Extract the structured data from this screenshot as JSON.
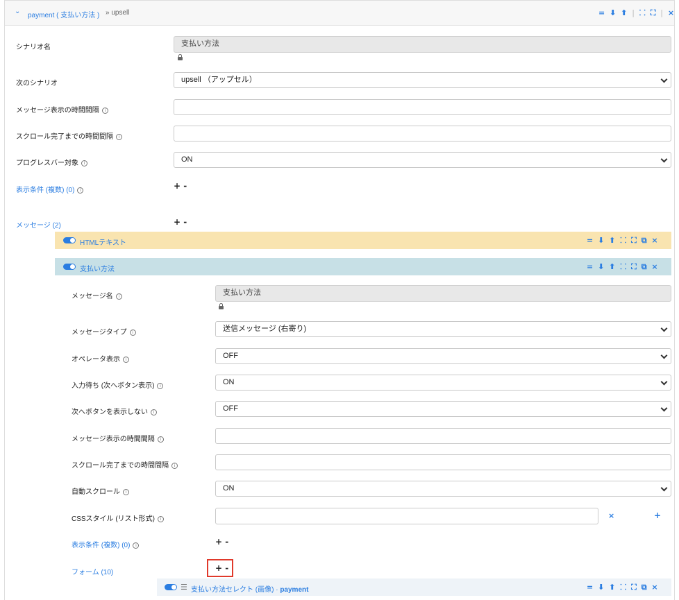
{
  "header": {
    "title": "payment ( 支払い方法 )",
    "crumb": "» upsell"
  },
  "tools": {
    "eq": "=",
    "down": "⬇",
    "up": "⬆",
    "sep": "|",
    "collapse": "⸬",
    "expand": "⛶",
    "copy": "⧉",
    "close": "×"
  },
  "scenario": {
    "name_label": "シナリオ名",
    "name_value": "支払い方法",
    "next_label": "次のシナリオ",
    "next_value": "upsell （アップセル）",
    "interval_label": "メッセージ表示の時間間隔",
    "scroll_label": "スクロール完了までの時間間隔",
    "progress_label": "プログレスバー対象",
    "progress_value": "ON",
    "conditions_label": "表示条件 (複数) (0)",
    "messages_label": "メッセージ (2)"
  },
  "plusminus": "+ -",
  "message_bars": [
    {
      "title": "HTMLテキスト",
      "color": "#f9e4b0"
    },
    {
      "title": "支払い方法",
      "color": "#c7e0e6"
    }
  ],
  "message": {
    "name_label": "メッセージ名",
    "name_value": "支払い方法",
    "type_label": "メッセージタイプ",
    "type_value": "送信メッセージ (右寄り)",
    "operator_label": "オペレータ表示",
    "operator_value": "OFF",
    "wait_label": "入力待ち (次へボタン表示)",
    "wait_value": "ON",
    "hide_next_label": "次へボタンを表示しない",
    "hide_next_value": "OFF",
    "interval_label": "メッセージ表示の時間間隔",
    "scroll_label": "スクロール完了までの時間間隔",
    "autoscroll_label": "自動スクロール",
    "autoscroll_value": "ON",
    "css_label": "CSSスタイル (リスト形式)",
    "conditions_label": "表示条件 (複数) (0)",
    "forms_label": "フォーム (10)"
  },
  "form_bar": {
    "title": "支払い方法セレクト (画像) · ",
    "suffix": "payment",
    "color": "#eef3f8"
  },
  "colors": {
    "accent": "#2a7de1",
    "highlight": "#e0392b"
  }
}
